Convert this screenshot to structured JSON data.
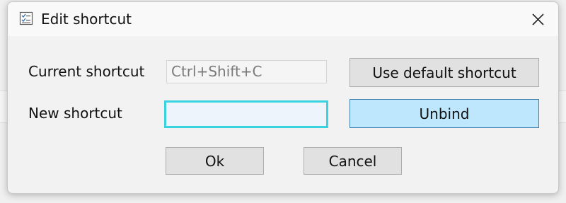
{
  "window": {
    "title": "Edit shortcut",
    "icon": "checklist-icon",
    "close_icon": "close-icon"
  },
  "form": {
    "current_label": "Current shortcut",
    "current_value": "Ctrl+Shift+C",
    "new_label": "New shortcut",
    "new_value": ""
  },
  "buttons": {
    "use_default": "Use default shortcut",
    "unbind": "Unbind",
    "ok": "Ok",
    "cancel": "Cancel"
  },
  "colors": {
    "focus_border": "#38d3df",
    "unbind_bg": "#bee6fd",
    "button_bg": "#e1e1e1"
  }
}
